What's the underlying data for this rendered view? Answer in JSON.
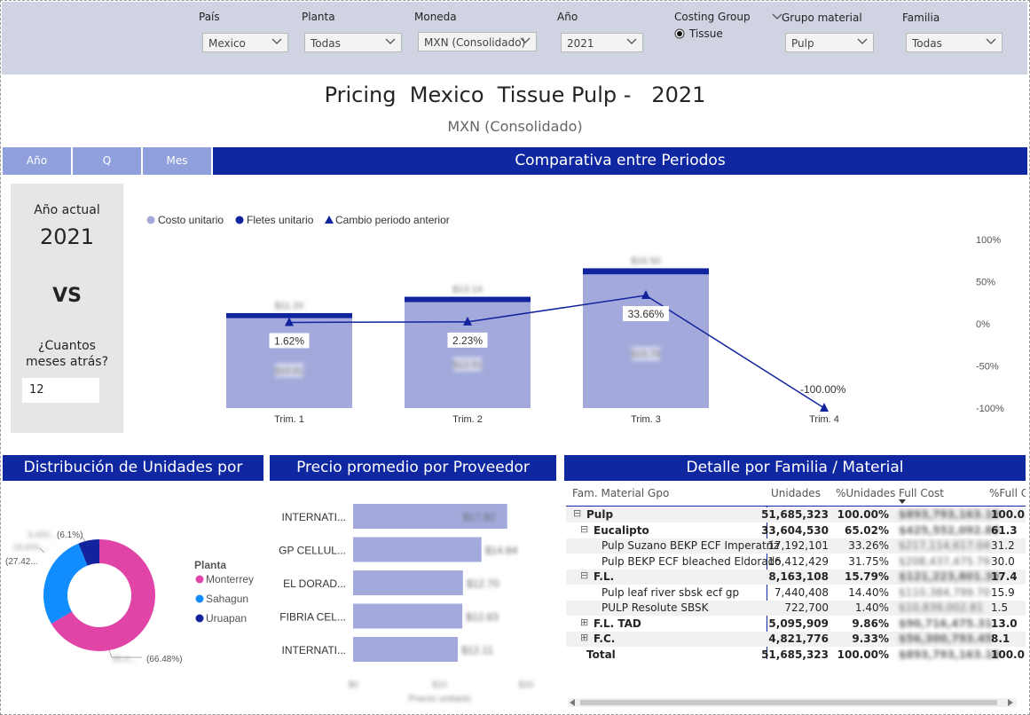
{
  "filters": [
    {
      "label": "País",
      "value": "Mexico"
    },
    {
      "label": "Planta",
      "value": "Todas"
    },
    {
      "label": "Moneda",
      "value": "MXN (Consolidado)"
    },
    {
      "label": "Año",
      "value": "2021"
    },
    {
      "label": "Grupo material",
      "value": "Pulp"
    },
    {
      "label": "Familia",
      "value": "Todas"
    }
  ],
  "costing_group": {
    "label": "Costing Group",
    "option": "Tissue"
  },
  "header": {
    "title": "Pricing  Mexico  Tissue Pulp -   2021",
    "subtitle": "MXN (Consolidado)"
  },
  "tabs": [
    "Año",
    "Q",
    "Mes"
  ],
  "sections": {
    "comparativa": "Comparativa entre Periodos",
    "distribucion": "Distribución de Unidades por Planta",
    "precio": "Precio promedio por Proveedor",
    "detalle": "Detalle por Familia / Material"
  },
  "left_panel": {
    "label": "Año actual",
    "year": "2021",
    "vs": "VS",
    "question": "¿Cuantos meses atrás?",
    "input_value": "12"
  },
  "colors": {
    "navy": "#1027a2",
    "lavender": "#a3aadb",
    "pink": "#e044a7",
    "blue": "#118dff",
    "darknavy": "#12239e"
  },
  "chart_data": [
    {
      "type": "bar",
      "title": "Comparativa entre Periodos",
      "categories": [
        "Trim. 1",
        "Trim. 2",
        "Trim. 3",
        "Trim. 4"
      ],
      "legend": [
        "Costo unitario",
        "Fletes unitario",
        "Cambio periodo anterior"
      ],
      "series": [
        {
          "name": "Costo unitario",
          "values": [
            10.61,
            12.51,
            15.78,
            null
          ]
        },
        {
          "name": "Fletes unitario",
          "values": [
            0.6,
            0.63,
            0.72,
            null
          ]
        },
        {
          "name": "Cambio periodo anterior",
          "type": "line",
          "values": [
            1.62,
            2.23,
            33.66,
            -100.0
          ]
        }
      ],
      "total_labels": [
        "$11.20",
        "$13.14",
        "$16.50"
      ],
      "value_labels": [
        "$10.61",
        "$12.51",
        "$15.78"
      ],
      "change_labels": [
        "1.62%",
        "2.23%",
        "33.66%",
        "-100.00%"
      ],
      "y_right_ticks": [
        "100%",
        "50%",
        "0%",
        "-50%",
        "-100%"
      ],
      "y_right_range": [
        -100,
        100
      ]
    },
    {
      "type": "pie",
      "title": "Distribución de Unidades por Planta",
      "legend_title": "Planta",
      "slices": [
        {
          "name": "Monterrey",
          "value": 66.48,
          "color": "#e044a7"
        },
        {
          "name": "Sahagun",
          "value": 27.42,
          "color": "#118dff"
        },
        {
          "name": "Uruapan",
          "value": 6.1,
          "color": "#12239e"
        }
      ],
      "slice_labels": [
        "(66.48%)",
        "(27.42...",
        "(6.1%)"
      ]
    },
    {
      "type": "bar",
      "orientation": "horizontal",
      "title": "Precio promedio por Proveedor",
      "categories": [
        "INTERNATI...",
        "GP CELLUL...",
        "EL DORAD...",
        "FIBRIA CEL...",
        "INTERNATI..."
      ],
      "values": [
        17.82,
        14.84,
        12.7,
        12.63,
        12.11
      ],
      "value_labels": [
        "$17.82",
        "$14.84",
        "$12.70",
        "$12.63",
        "$12.11"
      ],
      "x_ticks": [
        "$0",
        "$10",
        "$20"
      ],
      "xlim": [
        0,
        20
      ],
      "xlabel": "Precio unitario"
    }
  ],
  "table": {
    "headers": [
      "Fam. Material Gpo",
      "Unidades",
      "%Unidades",
      "Full Cost",
      "%Full C"
    ],
    "rows": [
      {
        "name": "Pulp",
        "expander": "⊟",
        "level": 0,
        "bold": true,
        "unidades": "51,685,323",
        "pct": "100.00%",
        "full": "$893,793,163.18",
        "pfull": "100.0"
      },
      {
        "name": "Eucalipto",
        "expander": "⊟",
        "level": 1,
        "bold": true,
        "unidades": "33,604,530",
        "pct": "65.02%",
        "full": "$425,552,092.83",
        "pfull": "61.3"
      },
      {
        "name": "Pulp Suzano BEKP ECF Imperatriz",
        "expander": "",
        "level": 2,
        "bold": false,
        "unidades": "17,192,101",
        "pct": "33.26%",
        "full": "$217,114,617.04",
        "pfull": "31.2"
      },
      {
        "name": "Pulp BEKP ECF bleached Eldorado",
        "expander": "",
        "level": 2,
        "bold": false,
        "unidades": "16,412,429",
        "pct": "31.75%",
        "full": "$208,437,475.79",
        "pfull": "30.0"
      },
      {
        "name": "F.L.",
        "expander": "⊟",
        "level": 1,
        "bold": true,
        "unidades": "8,163,108",
        "pct": "15.79%",
        "full": "$121,223,801.39",
        "pfull": "17.4"
      },
      {
        "name": "Pulp leaf river sbsk ecf gp",
        "expander": "",
        "level": 2,
        "bold": false,
        "unidades": "7,440,408",
        "pct": "14.40%",
        "full": "$110,384,799.70",
        "pfull": "15.9"
      },
      {
        "name": "PULP Resolute SBSK",
        "expander": "",
        "level": 2,
        "bold": false,
        "unidades": "722,700",
        "pct": "1.40%",
        "full": "$10,839,002.81",
        "pfull": "1.5"
      },
      {
        "name": "F.L. TAD",
        "expander": "⊞",
        "level": 1,
        "bold": true,
        "unidades": "5,095,909",
        "pct": "9.86%",
        "full": "$90,716,475.31",
        "pfull": "13.0"
      },
      {
        "name": "F.C.",
        "expander": "⊞",
        "level": 1,
        "bold": true,
        "unidades": "4,821,776",
        "pct": "9.33%",
        "full": "$56,300,793.45",
        "pfull": "8.1"
      },
      {
        "name": "Total",
        "expander": "",
        "level": 1,
        "bold": true,
        "unidades": "51,685,323",
        "pct": "100.00%",
        "full": "$893,793,163.18",
        "pfull": "100.0"
      }
    ]
  }
}
